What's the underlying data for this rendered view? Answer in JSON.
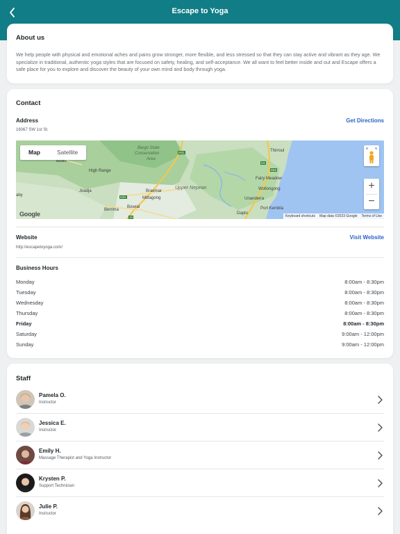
{
  "header": {
    "title": "Escape to Yoga",
    "back_icon": "chevron-left-icon"
  },
  "about": {
    "heading": "About us",
    "body": "We help people with physical and emotional aches and pains grow stronger, more flexible, and less stressed so that they can stay active and vibrant as they age.  We specialize in traditional, authentic yoga styles that are focused on safety, healing, and self-acceptance.  We all want to feel better inside and out and Escape offers a safe place for you to explore and discover the beauty of your own mind and body through yoga."
  },
  "contact": {
    "heading": "Contact",
    "address_label": "Address",
    "address": "16067 SW 1st St.",
    "directions_link": "Get Directions",
    "map": {
      "toggle_map": "Map",
      "toggle_satellite": "Satellite",
      "zoom_in": "+",
      "zoom_out": "−",
      "logo": "Google",
      "keyboard_shortcuts": "Keyboard shortcuts",
      "map_data": "Map data ©2023 Google",
      "terms": "Terms of Use",
      "places": [
        "Bargo State",
        "Conservation",
        "Area",
        "Bullio",
        "High Range",
        "Joadja",
        "Braemar",
        "Mittagong",
        "Bowral",
        "Berrima",
        "Upper Nepean",
        "Thirroul",
        "Fairy Meadow",
        "Wollongong",
        "Unanderra",
        "Port Kembla",
        "Dapto",
        "aby",
        "M31",
        "M1",
        "B65",
        "15"
      ]
    },
    "website_label": "Website",
    "website": "http://escapetoyoga.com/",
    "website_link": "Visit Website",
    "hours_label": "Business Hours",
    "hours": [
      {
        "day": "Monday",
        "time": "8:00am - 8:30pm"
      },
      {
        "day": "Tuesday",
        "time": "8:00am - 8:30pm"
      },
      {
        "day": "Wednesday",
        "time": "8:00am - 8:30pm"
      },
      {
        "day": "Thursday",
        "time": "8:00am - 8:30pm"
      },
      {
        "day": "Friday",
        "time": "8:00am - 8:30pm"
      },
      {
        "day": "Saturday",
        "time": "9:00am - 12:00pm"
      },
      {
        "day": "Sunday",
        "time": "9:00am - 12:00pm"
      }
    ]
  },
  "staff": {
    "heading": "Staff",
    "members": [
      {
        "name": "Pamela O.",
        "role": "Instructor"
      },
      {
        "name": "Jessica E.",
        "role": "Instructor"
      },
      {
        "name": "Emily H.",
        "role": "Massage Therapist and Yoga Instructor"
      },
      {
        "name": "Krysten P.",
        "role": "Support Technician"
      },
      {
        "name": "Julie P.",
        "role": "Instructor"
      }
    ]
  },
  "colors": {
    "header": "#117d86",
    "link": "#2b64c8",
    "background": "#eef0f1"
  }
}
